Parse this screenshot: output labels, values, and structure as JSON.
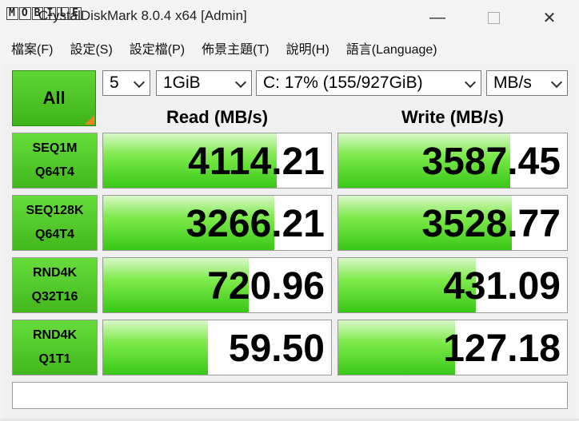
{
  "window": {
    "logo_text": "MOBILE01",
    "title": "CrystalDiskMark 8.0.4 x64 [Admin]",
    "minimize": "—",
    "close": "✕"
  },
  "menu": [
    "檔案(F)",
    "設定(S)",
    "設定檔(P)",
    "佈景主題(T)",
    "說明(H)",
    "語言(Language)"
  ],
  "controls": {
    "all_label": "All",
    "count": "5",
    "size": "1GiB",
    "drive": "C: 17% (155/927GiB)",
    "unit": "MB/s"
  },
  "headers": {
    "read": "Read (MB/s)",
    "write": "Write (MB/s)"
  },
  "rows": [
    {
      "line1": "SEQ1M",
      "line2": "Q64T4",
      "read": "4114.21",
      "write": "3587.45",
      "read_fill": 0.76,
      "write_fill": 0.75
    },
    {
      "line1": "SEQ128K",
      "line2": "Q64T4",
      "read": "3266.21",
      "write": "3528.77",
      "read_fill": 0.75,
      "write_fill": 0.76
    },
    {
      "line1": "RND4K",
      "line2": "Q32T16",
      "read": "720.96",
      "write": "431.09",
      "read_fill": 0.64,
      "write_fill": 0.6
    },
    {
      "line1": "RND4K",
      "line2": "Q1T1",
      "read": "59.50",
      "write": "127.18",
      "read_fill": 0.46,
      "write_fill": 0.51
    }
  ],
  "comment": ""
}
